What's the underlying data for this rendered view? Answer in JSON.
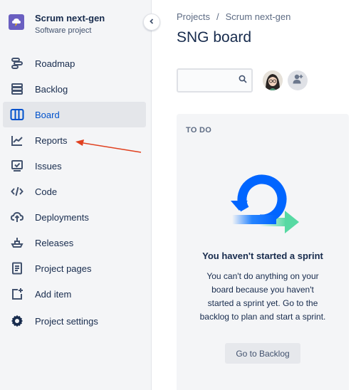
{
  "project": {
    "name": "Scrum next-gen",
    "type": "Software project",
    "icon": "project-avatar-icon"
  },
  "sidebar": {
    "collapse_icon": "chevron-left-icon",
    "items": [
      {
        "label": "Roadmap",
        "icon": "roadmap-icon",
        "active": false
      },
      {
        "label": "Backlog",
        "icon": "backlog-icon",
        "active": false
      },
      {
        "label": "Board",
        "icon": "board-icon",
        "active": true
      },
      {
        "label": "Reports",
        "icon": "reports-icon",
        "active": false
      },
      {
        "label": "Issues",
        "icon": "issues-icon",
        "active": false
      },
      {
        "label": "Code",
        "icon": "code-icon",
        "active": false
      },
      {
        "label": "Deployments",
        "icon": "deployments-icon",
        "active": false
      },
      {
        "label": "Releases",
        "icon": "releases-icon",
        "active": false
      },
      {
        "label": "Project pages",
        "icon": "project-pages-icon",
        "active": false
      },
      {
        "label": "Add item",
        "icon": "add-item-icon",
        "active": false
      },
      {
        "label": "Project settings",
        "icon": "settings-icon",
        "active": false
      }
    ]
  },
  "header": {
    "breadcrumb": [
      "Projects",
      "Scrum next-gen"
    ],
    "breadcrumb_sep": "/",
    "title": "SNG board"
  },
  "toolbar": {
    "search_placeholder": "",
    "search_icon": "search-icon",
    "avatar": "user-avatar",
    "add_people_icon": "add-people-icon"
  },
  "board": {
    "column_title": "TO DO",
    "empty_title": "You haven't started a sprint",
    "empty_desc": "You can't do anything on your board because you haven't started a sprint yet. Go to the backlog to plan and start a sprint.",
    "button_label": "Go to Backlog"
  },
  "annotation": {
    "arrow_color": "#e0401f",
    "points_to": "Reports"
  },
  "colors": {
    "accent": "#0052cc",
    "sidebar_bg": "#f4f5f7",
    "active_bg": "#e4e6ea"
  }
}
